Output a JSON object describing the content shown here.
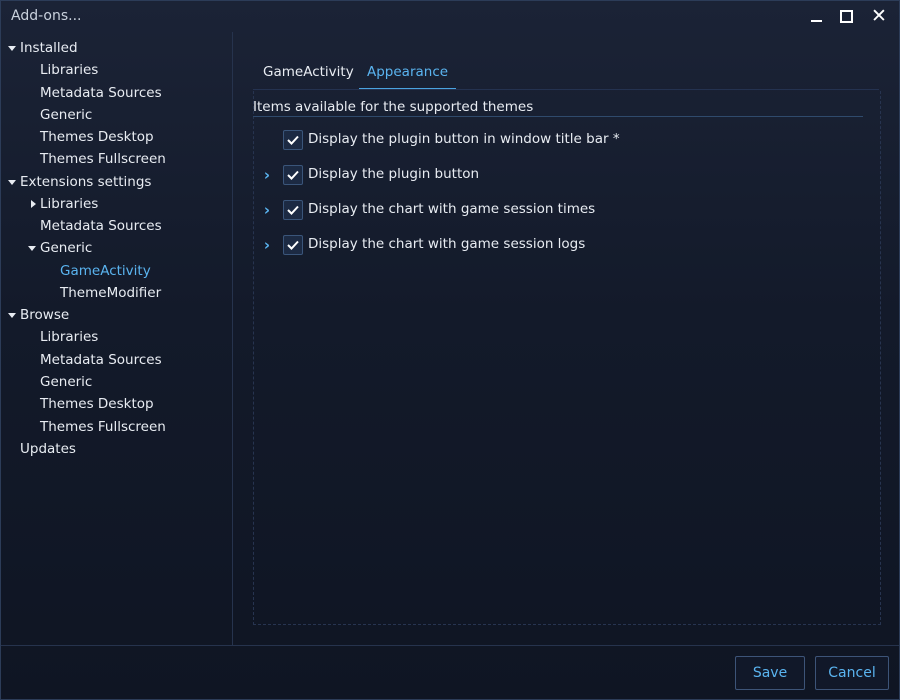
{
  "window": {
    "title": "Add-ons..."
  },
  "sidebar": {
    "installed": {
      "label": "Installed",
      "items": [
        "Libraries",
        "Metadata Sources",
        "Generic",
        "Themes Desktop",
        "Themes Fullscreen"
      ]
    },
    "extensions_settings": {
      "label": "Extensions settings",
      "libraries": "Libraries",
      "metadata_sources": "Metadata Sources",
      "generic": {
        "label": "Generic",
        "children": [
          "GameActivity",
          "ThemeModifier"
        ],
        "selected": "GameActivity"
      }
    },
    "browse": {
      "label": "Browse",
      "items": [
        "Libraries",
        "Metadata Sources",
        "Generic",
        "Themes Desktop",
        "Themes Fullscreen"
      ]
    },
    "updates": "Updates"
  },
  "main": {
    "tabs": [
      "GameActivity",
      "Appearance"
    ],
    "active_tab": "Appearance",
    "section_title": "Items available for the supported themes",
    "options": [
      {
        "label": "Display the plugin button in window title bar *",
        "checked": true,
        "expandable": false
      },
      {
        "label": "Display the plugin button",
        "checked": true,
        "expandable": true
      },
      {
        "label": "Display the chart with game session times",
        "checked": true,
        "expandable": true
      },
      {
        "label": "Display the chart with game session logs",
        "checked": true,
        "expandable": true
      }
    ]
  },
  "footer": {
    "save_label": "Save",
    "cancel_label": "Cancel"
  },
  "colors": {
    "accent": "#5ab4f0",
    "background": "#141b2b",
    "text": "#e8ecf2"
  }
}
